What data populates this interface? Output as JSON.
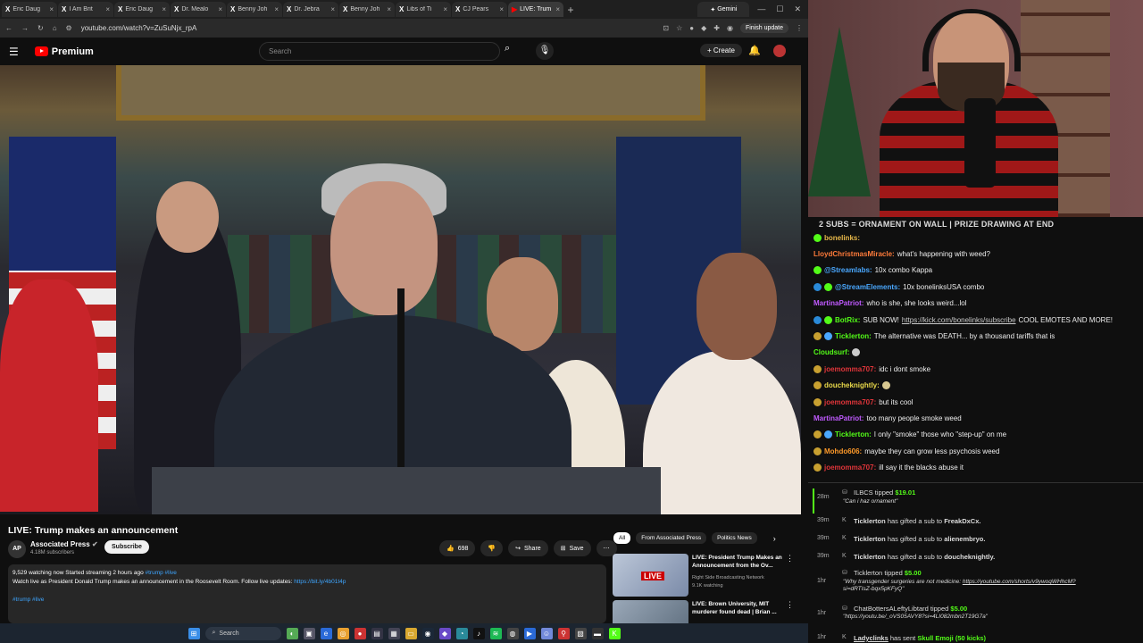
{
  "browser": {
    "tabs": [
      {
        "label": "Eric Daug",
        "active": false
      },
      {
        "label": "I Am Brit",
        "active": false
      },
      {
        "label": "Eric Daug",
        "active": false
      },
      {
        "label": "Dr. Mealo",
        "active": false
      },
      {
        "label": "Benny Joh",
        "active": false
      },
      {
        "label": "Dr. Jebra",
        "active": false
      },
      {
        "label": "Benny Joh",
        "active": false
      },
      {
        "label": "Libs of Ti",
        "active": false
      },
      {
        "label": "CJ Pears",
        "active": false
      },
      {
        "label": "LIVE: Trum",
        "active": true
      }
    ],
    "gemini_label": "Gemini",
    "url": "youtube.com/watch?v=ZuSuNjx_rpA",
    "update_label": "Finish update"
  },
  "youtube": {
    "brand": "Premium",
    "search_placeholder": "Search",
    "create_label": "Create",
    "video_title": "LIVE: Trump makes an announcement",
    "channel_name": "Associated Press",
    "channel_avatar": "AP",
    "subscribers": "4.18M subscribers",
    "subscribe_label": "Subscribe",
    "likes": "698",
    "share_label": "Share",
    "save_label": "Save",
    "desc_meta": "9,529 watching now  Started streaming 2 hours ago",
    "desc_tags": "#trump #live",
    "desc_text": "Watch live as President Donald Trump makes an announcement in the Roosevelt Room. Follow live updates:",
    "desc_link": "https://bit.ly/4b01t4p",
    "desc_tags2": "#trump #live",
    "chips": [
      "All",
      "From Associated Press",
      "Politics News"
    ],
    "recs": [
      {
        "title": "LIVE: President Trump Makes an Announcement from the Ov...",
        "channel": "Right Side Broadcasting Network",
        "watching": "9.1K watching",
        "badge": "LIVE"
      },
      {
        "title": "LIVE: Brown University, MIT murderer found dead | Brian ...",
        "channel": "",
        "watching": "",
        "badge": ""
      }
    ]
  },
  "taskbar": {
    "search_label": "Search"
  },
  "stream": {
    "banner": "2 SUBS = ORNAMENT ON WALL | PRIZE DRAWING AT END",
    "chat": [
      {
        "nick": "bonelinks:",
        "text": "",
        "color": "#e8b84a"
      },
      {
        "nick": "LloydChristmasMiracle:",
        "text": "what's happening with weed?",
        "color": "#ff7b3a"
      },
      {
        "nick": "@Streamlabs:",
        "text": "10x combo Kappa",
        "color": "#4aa8ff"
      },
      {
        "nick": "@StreamElements:",
        "text": "10x bonelinksUSA combo",
        "color": "#4aa8ff"
      },
      {
        "nick": "MartinaPatriot:",
        "text": "who is she, she looks weird...lol",
        "color": "#c05aff"
      },
      {
        "nick": "BotRix:",
        "text": "SUB NOW!",
        "link": "https://kick.com/bonelinks/subscribe",
        "text2": "COOL EMOTES AND MORE!",
        "color": "#53fc18"
      },
      {
        "nick": "Ticklerton:",
        "text": "The alternative was DEATH... by a thousand tariffs that is",
        "color": "#53fc18"
      },
      {
        "nick": "Cloudsurf:",
        "text": "",
        "color": "#53fc18"
      },
      {
        "nick": "joemomma707:",
        "text": "idc i dont smoke",
        "color": "#e0353a"
      },
      {
        "nick": "doucheknightly:",
        "text": "",
        "color": "#e8d84a"
      },
      {
        "nick": "joemomma707:",
        "text": "but its cool",
        "color": "#e0353a"
      },
      {
        "nick": "MartinaPatriot:",
        "text": "too many people smoke weed",
        "color": "#c05aff"
      },
      {
        "nick": "Ticklerton:",
        "text": "I only \"smoke\" those who \"step-up\" on me",
        "color": "#53fc18"
      },
      {
        "nick": "Mohdo606:",
        "text": "maybe they can grow less psychosis weed",
        "color": "#ff9a2a"
      },
      {
        "nick": "joemomma707:",
        "text": "ill say it the blacks abuse it",
        "color": "#e0353a"
      }
    ],
    "events": [
      {
        "time": "28m",
        "name": "ILBCS",
        "action": "tipped",
        "amount": "$19.01",
        "note": "\"Can i haz ornament\""
      },
      {
        "time": "39m",
        "name": "Ticklerton",
        "action": "has gifted a sub to",
        "target": "FreakDxCx."
      },
      {
        "time": "39m",
        "name": "Ticklerton",
        "action": "has gifted a sub to",
        "target": "alienembryo."
      },
      {
        "time": "39m",
        "name": "Ticklerton",
        "action": "has gifted a sub to",
        "target": "doucheknightly."
      },
      {
        "time": "1hr",
        "name": "Ticklerton",
        "action": "tipped",
        "amount": "$5.00",
        "note": "\"Why transgender surgeries are not medicine:",
        "link": "https://youtube.com/shorts/v9ywoqWHhcM?",
        "note2": "si=dRTIsZ-bqx5pKFyQ\""
      },
      {
        "time": "1hr",
        "name": "ChatBottersALeftyLibtard",
        "action": "tipped",
        "amount": "$5.00",
        "note": "\"https://youtu.be/_oVS05AVY8?si=4LI082mbn2T19G7a\""
      },
      {
        "time": "1hr",
        "name": "Ladyclinks",
        "action": "has sent",
        "amount": "Skull Emoji (50 kicks)"
      }
    ]
  }
}
